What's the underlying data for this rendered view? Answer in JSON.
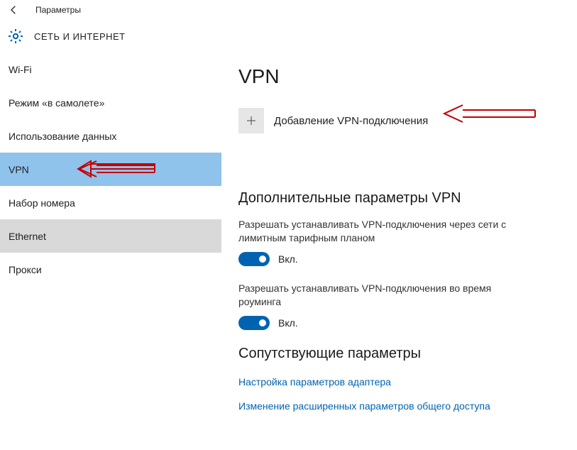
{
  "window": {
    "title": "Параметры"
  },
  "header": {
    "title": "СЕТЬ И ИНТЕРНЕТ"
  },
  "sidebar": {
    "items": [
      {
        "label": "Wi-Fi"
      },
      {
        "label": "Режим «в самолете»"
      },
      {
        "label": "Использование данных"
      },
      {
        "label": "VPN"
      },
      {
        "label": "Набор номера"
      },
      {
        "label": "Ethernet"
      },
      {
        "label": "Прокси"
      }
    ]
  },
  "main": {
    "title": "VPN",
    "add_label": "Добавление VPN-подключения",
    "advanced": {
      "heading": "Дополнительные параметры VPN",
      "opt1_label": "Разрешать устанавливать VPN-подключения через сети с лимитным тарифным планом",
      "opt1_state": "Вкл.",
      "opt2_label": "Разрешать устанавливать VPN-подключения во время роуминга",
      "opt2_state": "Вкл."
    },
    "related": {
      "heading": "Сопутствующие параметры",
      "link1": "Настройка параметров адаптера",
      "link2": "Изменение расширенных параметров общего доступа"
    }
  }
}
